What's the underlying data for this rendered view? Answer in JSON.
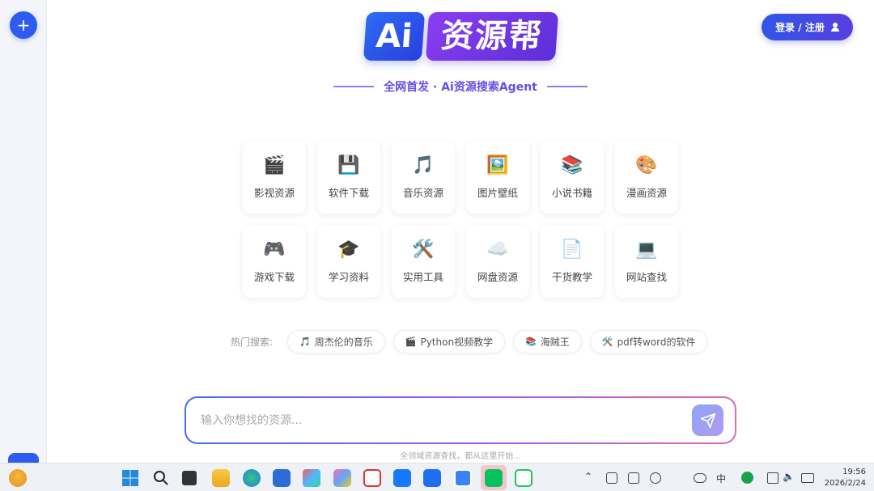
{
  "sidebar": {
    "new_label": "+"
  },
  "header": {
    "login_label": "登录 / 注册"
  },
  "logo": {
    "ai": "Ai",
    "cn": "资源帮"
  },
  "tagline": "全网首发 · Ai资源搜索Agent",
  "categories": [
    {
      "icon": "🎬",
      "icon_name": "clapperboard-icon",
      "label": "影视资源"
    },
    {
      "icon": "💾",
      "icon_name": "floppy-disk-icon",
      "label": "软件下载"
    },
    {
      "icon": "🎵",
      "icon_name": "music-note-icon",
      "label": "音乐资源"
    },
    {
      "icon": "🖼️",
      "icon_name": "framed-picture-icon",
      "label": "图片壁纸"
    },
    {
      "icon": "📚",
      "icon_name": "books-icon",
      "label": "小说书籍"
    },
    {
      "icon": "🎨",
      "icon_name": "palette-icon",
      "label": "漫画资源"
    },
    {
      "icon": "🎮",
      "icon_name": "gamepad-icon",
      "label": "游戏下载"
    },
    {
      "icon": "🎓",
      "icon_name": "graduation-cap-icon",
      "label": "学习资料"
    },
    {
      "icon": "🛠️",
      "icon_name": "tools-icon",
      "label": "实用工具"
    },
    {
      "icon": "☁️",
      "icon_name": "cloud-icon",
      "label": "网盘资源"
    },
    {
      "icon": "📄",
      "icon_name": "document-icon",
      "label": "干货教学"
    },
    {
      "icon": "💻",
      "icon_name": "laptop-icon",
      "label": "网站查找"
    }
  ],
  "hot_search": {
    "label": "热门搜索:",
    "chips": [
      {
        "icon": "🎵",
        "text": "周杰伦的音乐"
      },
      {
        "icon": "🎬",
        "text": "Python视频教学"
      },
      {
        "icon": "📚",
        "text": "海贼王"
      },
      {
        "icon": "🛠️",
        "text": "pdf转word的软件"
      }
    ]
  },
  "search": {
    "placeholder": "输入你想找的资源..."
  },
  "footer_hint": "全领域资源查找，都从这里开始...",
  "taskbar": {
    "ime": "中",
    "time": "19:56",
    "date": "2026/2/24"
  },
  "colors": {
    "accent": "#2f5cf0",
    "brand_purple": "#6a4ee6"
  }
}
